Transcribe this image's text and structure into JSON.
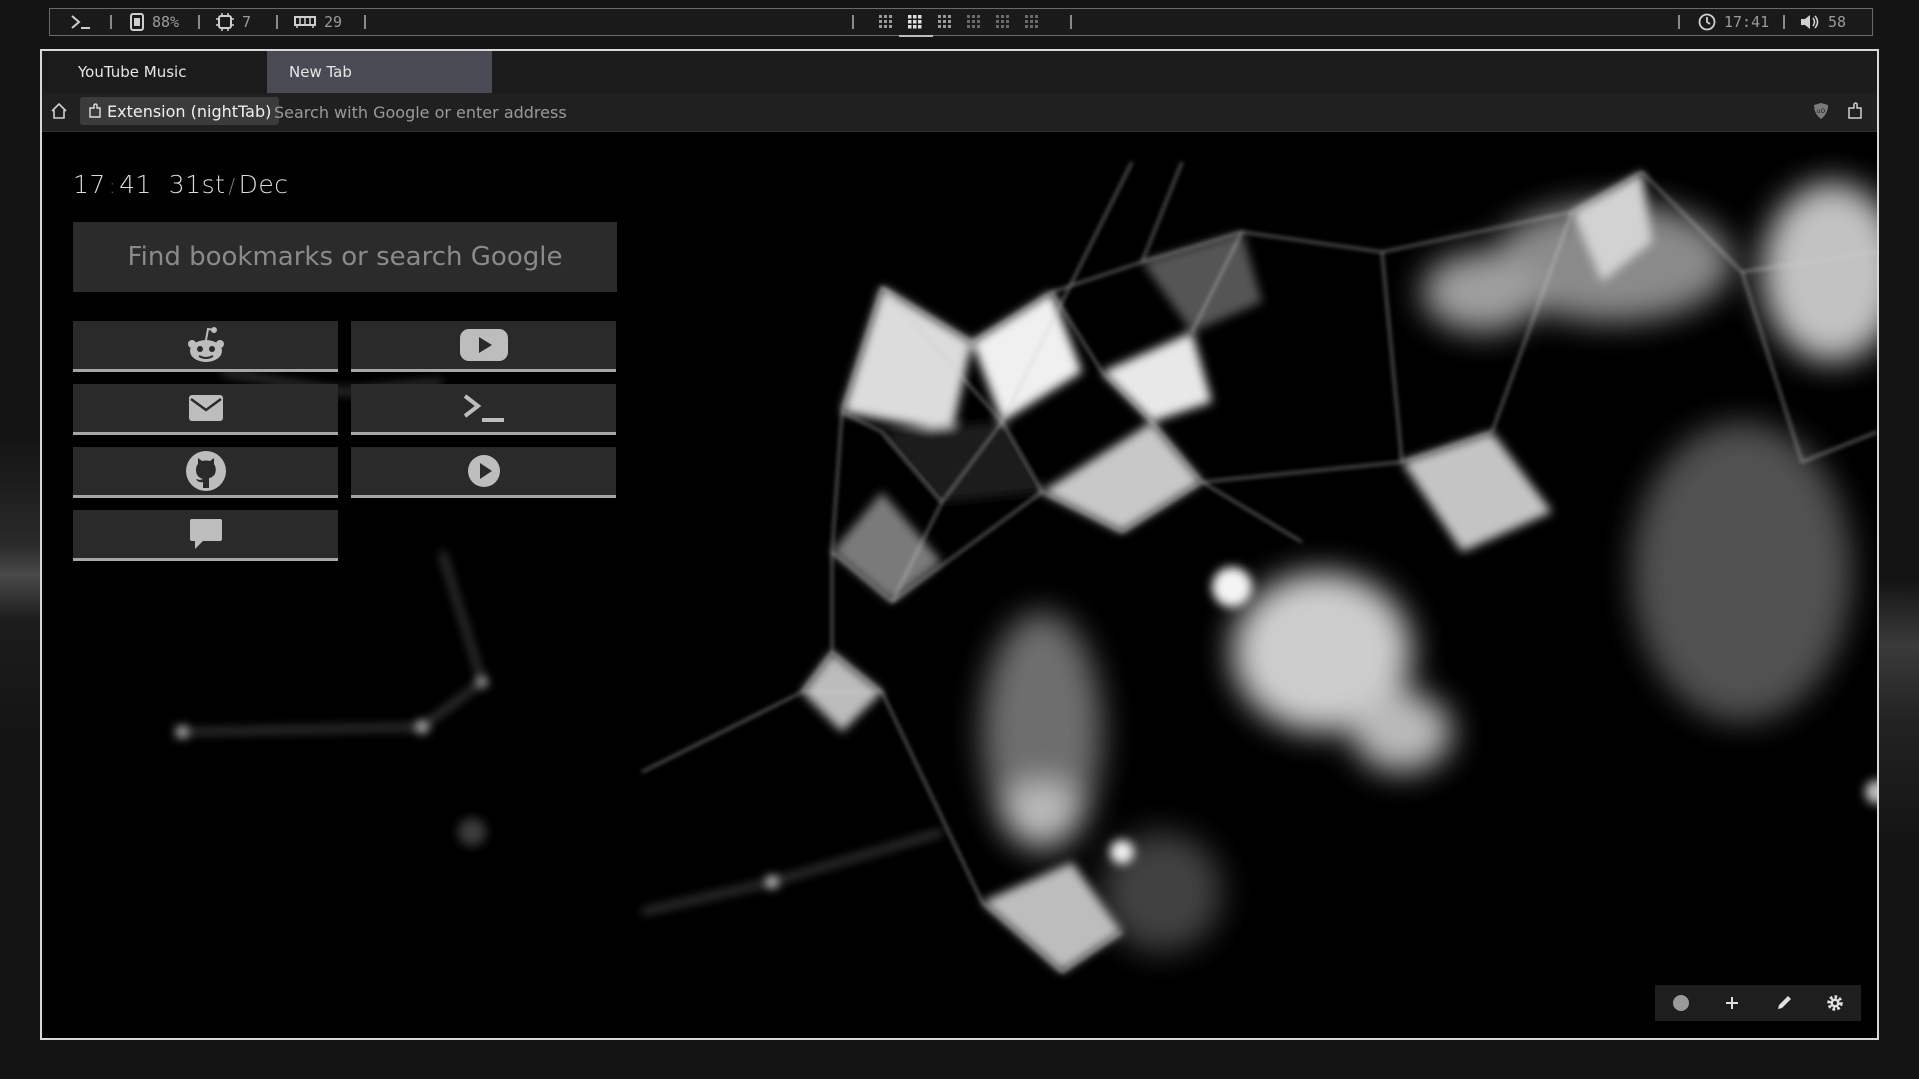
{
  "topbar": {
    "battery": "88%",
    "cpu": "7",
    "memory": "29",
    "clock": "17:41",
    "volume": "58",
    "workspaces": [
      "1",
      "2",
      "3",
      "4",
      "5",
      "6"
    ],
    "active_workspace": "2"
  },
  "tabs": [
    {
      "label": "YouTube Music",
      "active": false
    },
    {
      "label": "New Tab",
      "active": true
    }
  ],
  "navbar": {
    "extension_label": "Extension (nightTab)",
    "address_placeholder": "Search with Google or enter address"
  },
  "page": {
    "time_hours": "17",
    "time_sep": ":",
    "time_minutes": "41",
    "date_day": "31st",
    "date_sep": "/",
    "date_month": "Dec",
    "search_placeholder": "Find bookmarks or search Google"
  },
  "bookmarks": [
    {
      "name": "reddit",
      "icon": "reddit-icon"
    },
    {
      "name": "youtube",
      "icon": "youtube-icon"
    },
    {
      "name": "mail",
      "icon": "envelope-icon"
    },
    {
      "name": "terminal",
      "icon": "terminal-icon"
    },
    {
      "name": "github",
      "icon": "github-icon"
    },
    {
      "name": "play",
      "icon": "play-circle-icon"
    },
    {
      "name": "chat",
      "icon": "chat-bubble-icon"
    }
  ],
  "theme": {
    "accent": "#a6a6a6",
    "tile_bg": "#2a2a2a",
    "active_tab_bg": "#4a4a54"
  }
}
